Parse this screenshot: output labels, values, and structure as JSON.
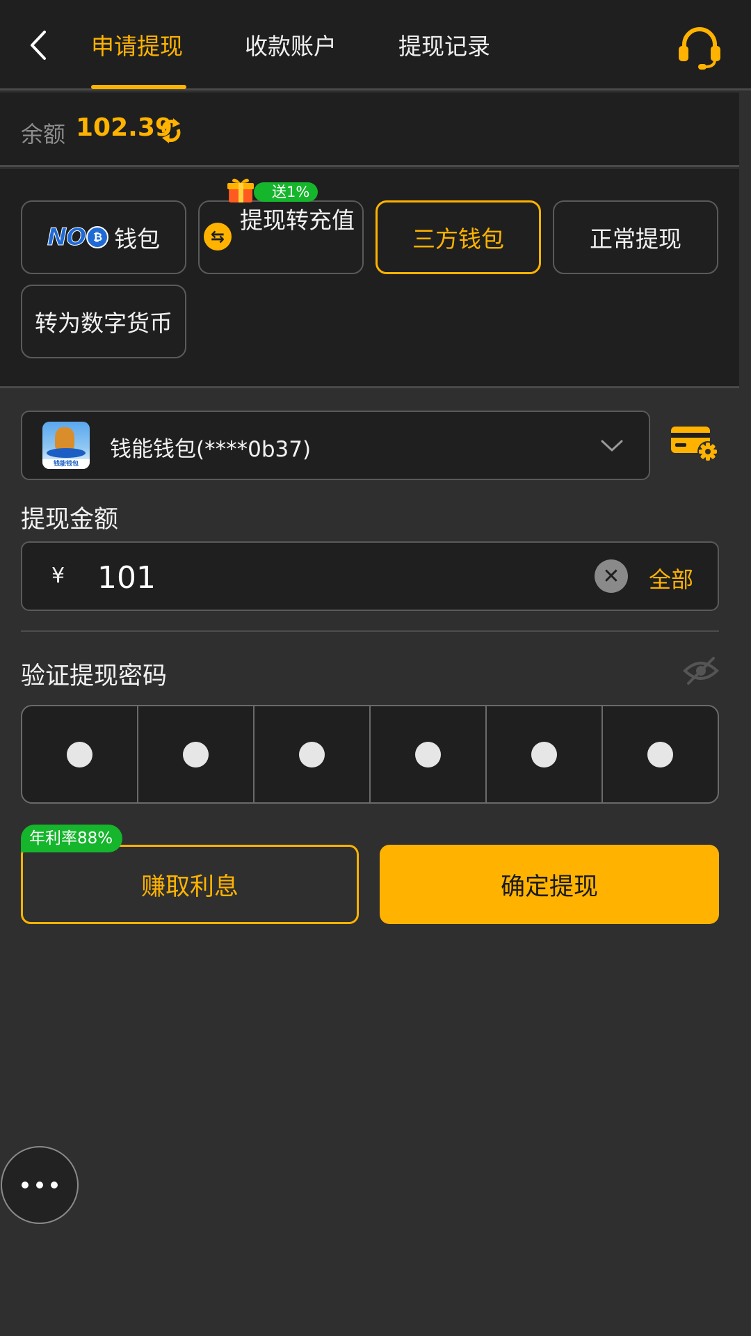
{
  "header": {
    "tabs": [
      {
        "label": "申请提现",
        "active": true
      },
      {
        "label": "收款账户",
        "active": false
      },
      {
        "label": "提现记录",
        "active": false
      }
    ],
    "back_icon": "chevron-left-icon",
    "support_icon": "headset-icon"
  },
  "balance": {
    "label": "余额",
    "value": "102.39",
    "refresh_icon": "refresh-icon"
  },
  "methods": {
    "no_wallet": {
      "logo_text": "NO",
      "label": "钱包"
    },
    "recharge": {
      "label": "提现转充值",
      "promo": "送1%",
      "icon": "swap-icon"
    },
    "third_party": {
      "label": "三方钱包",
      "selected": true
    },
    "normal": {
      "label": "正常提现"
    },
    "crypto": {
      "label": "转为数字货币"
    }
  },
  "wallet": {
    "name": "钱能钱包(****0b37)",
    "logo_caption": "钱能钱包"
  },
  "amount": {
    "label": "提现金额",
    "currency": "¥",
    "value": "101",
    "all_label": "全部"
  },
  "password": {
    "label": "验证提现密码",
    "filled_count": 6,
    "visibility_icon": "eye-off-icon"
  },
  "actions": {
    "earn_label": "赚取利息",
    "earn_badge": "年利率88%",
    "confirm_label": "确定提现"
  },
  "colors": {
    "accent": "#ffb300",
    "badge_green": "#15b52c",
    "background": "#2f2f2f",
    "panel": "#1f1f1f"
  }
}
